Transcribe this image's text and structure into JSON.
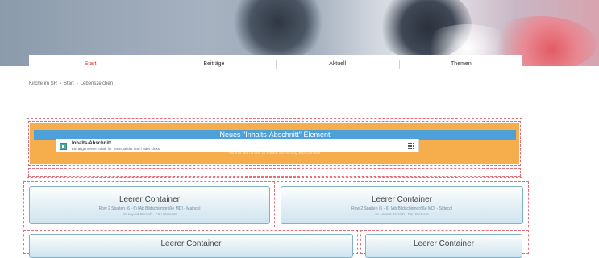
{
  "nav": {
    "items": [
      {
        "label": "Start",
        "active": true
      },
      {
        "label": "Beiträge",
        "active": false
      },
      {
        "label": "Aktuell",
        "active": false
      },
      {
        "label": "Themen",
        "active": false
      }
    ]
  },
  "breadcrumb": {
    "items": [
      "Kirche im SR",
      "›",
      "Start",
      "›",
      "Lebenszeichen"
    ]
  },
  "banner": {
    "heading": "Neues \"Inhalts-Abschnitt\" Element",
    "faint_text": "Fill this with a text or create something with content"
  },
  "popup": {
    "title": "Inhalts-Abschnitt",
    "description": "Ein allgemeiner Inhalt für Texte, Bilder und / oder Links."
  },
  "containers": [
    {
      "title": "Leerer Container",
      "line1": "Row 2 Spalten (6 - 6) [Ab Bildschirmgröße MD] - Maincol",
      "line2": "In: Layout-Bereich - Für: Element"
    },
    {
      "title": "Leerer Container",
      "line1": "Row 2 Spalten (6 - 6) [Ab Bildschirmgröße MD] - Sidecol",
      "line2": "In: Layout-Bereich - Für: Element"
    },
    {
      "title": "Leerer Container"
    },
    {
      "title": "Leerer Container"
    }
  ],
  "colors": {
    "nav_active": "#e03330",
    "banner_orange": "#f6ad4b",
    "banner_blue": "#4ea1d8",
    "dashed_outline": "#e06d78",
    "container_border": "#7fb2c9"
  }
}
